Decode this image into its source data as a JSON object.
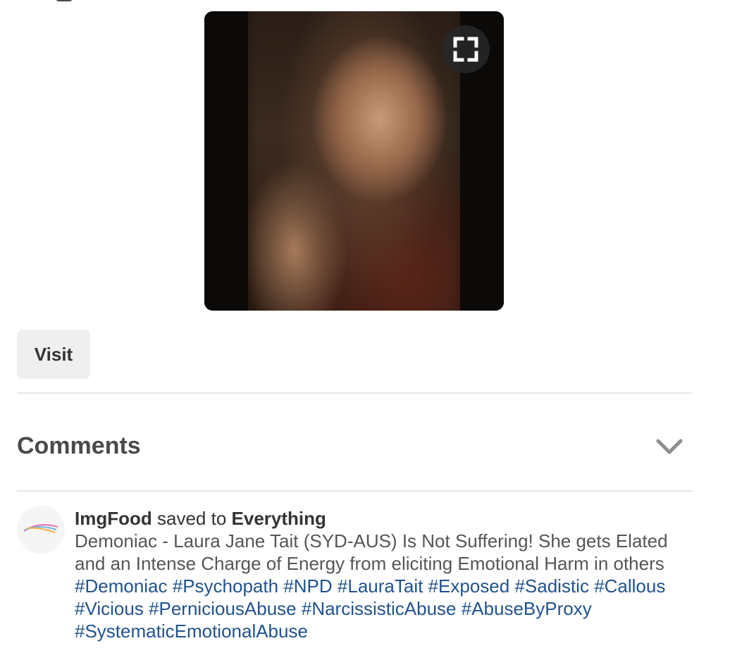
{
  "pin": {
    "image_alt": "Woman with long brown hair smiling and making a peace sign",
    "expand_icon": "expand-icon"
  },
  "visit_button": {
    "label": "Visit"
  },
  "comments": {
    "title": "Comments",
    "toggle_icon": "chevron-down-icon"
  },
  "save_activity": {
    "avatar_text": "ImgFood",
    "user": "ImgFood",
    "action": "saved to",
    "board": "Everything",
    "description_lines": [
      "Demoniac - Laura Jane Tait (SYD-AUS) Is Not Suffering! She gets Elated",
      "and an Intense Charge of Energy from eliciting Emotional Harm in others"
    ],
    "hashtags": [
      "#Demoniac",
      "#Psychopath",
      "#NPD",
      "#LauraTait",
      "#Exposed",
      "#Sadistic",
      "#Callous",
      "#Vicious",
      "#PerniciousAbuse",
      "#NarcissisticAbuse",
      "#AbuseByProxy",
      "#SystematicEmotionalAbuse"
    ]
  },
  "colors": {
    "hashtag": "#21538e",
    "button_bg": "#efefef",
    "divider": "#e6e6e6"
  }
}
